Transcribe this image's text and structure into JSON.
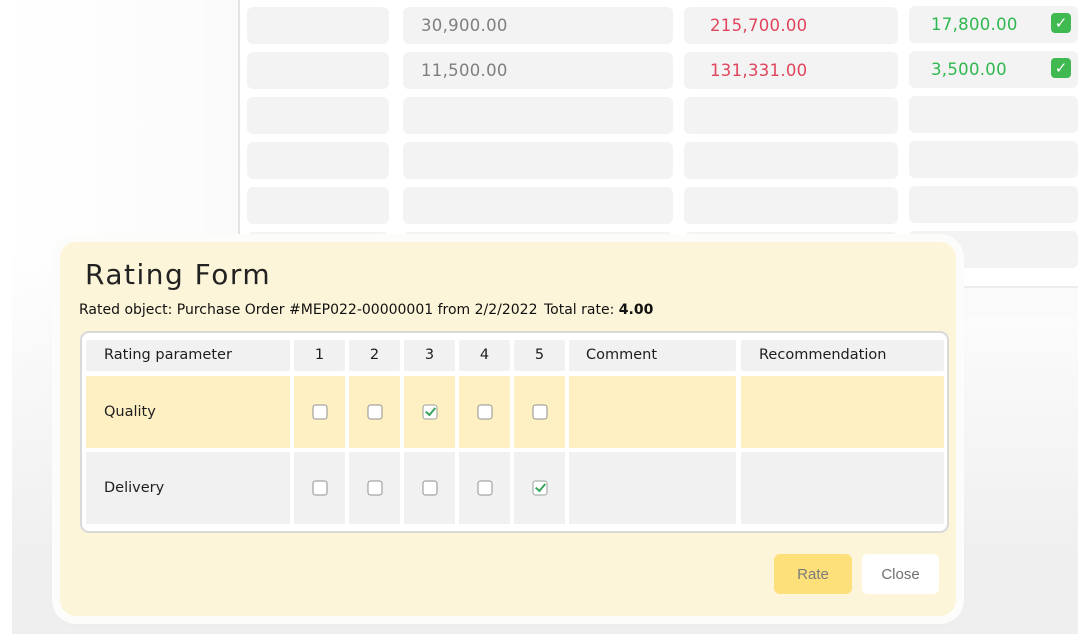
{
  "background_table": {
    "rows": [
      {
        "col2": "30,900.00",
        "col3": "215,700.00",
        "col4": "17,800.00",
        "checked": true
      },
      {
        "col2": "11,500.00",
        "col3": "131,331.00",
        "col4": "3,500.00",
        "checked": true
      }
    ],
    "check_icon": "check-mark-emoji-icon"
  },
  "modal": {
    "title": "Rating Form",
    "rated_object": "Rated object: Purchase Order #MEP022-00000001 from 2/2/2022",
    "total_label": "Total rate: ",
    "total_value": "4.00",
    "headers": {
      "parameter": "Rating parameter",
      "n1": "1",
      "n2": "2",
      "n3": "3",
      "n4": "4",
      "n5": "5",
      "comment": "Comment",
      "recommendation": "Recommendation"
    },
    "rows": [
      {
        "label": "Quality",
        "selected": 3,
        "comment": "",
        "recommendation": ""
      },
      {
        "label": "Delivery",
        "selected": 5,
        "comment": "",
        "recommendation": ""
      }
    ],
    "buttons": {
      "rate": "Rate",
      "close": "Close"
    }
  },
  "colors": {
    "modal_bg": "#fdf5d9",
    "highlight_row": "#fef0c3",
    "rate_button": "#fde07a",
    "negative_amount": "#e0455d",
    "positive_amount": "#2fb84f"
  }
}
